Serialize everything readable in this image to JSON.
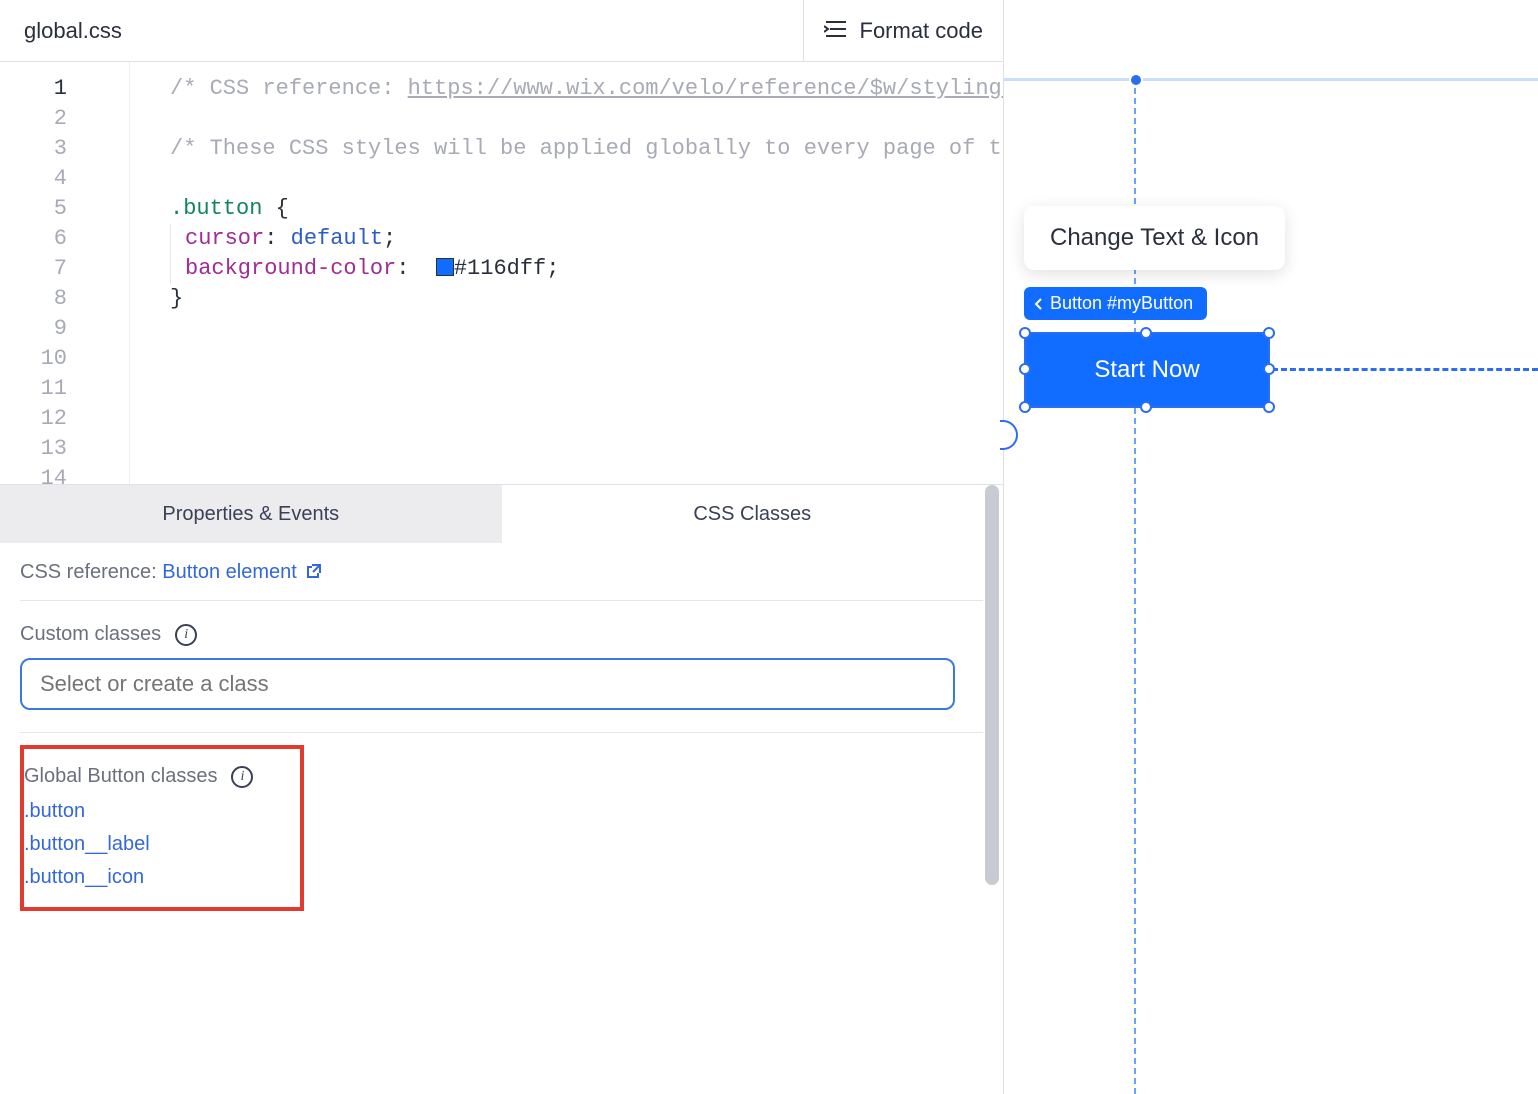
{
  "header": {
    "filename": "global.css",
    "format_label": "Format code"
  },
  "editor": {
    "line_count": 14,
    "active_line": 1,
    "lines": {
      "l1_comment_prefix": "/* CSS reference: ",
      "l1_link": "https://www.wix.com/velo/reference/$w/styling-elem",
      "l3_comment": "/* These CSS styles will be applied globally to every page of this s",
      "l5_selector": ".button",
      "l5_brace": " {",
      "l6_prop": "cursor",
      "l6_value": "default",
      "l7_prop": "background-color",
      "l7_hex": "#116dff",
      "l8_brace": "}"
    },
    "swatch_color": "#116dff"
  },
  "panel": {
    "tabs": {
      "properties": "Properties & Events",
      "css": "CSS Classes"
    },
    "ref_label": "CSS reference: ",
    "ref_link": "Button element",
    "custom_label": "Custom classes",
    "custom_placeholder": "Select or create a class",
    "global_label": "Global Button classes",
    "global_classes": [
      ".button",
      ".button__label",
      ".button__icon"
    ]
  },
  "canvas": {
    "popover_label": "Change Text & Icon",
    "crumb_label": "Button #myButton",
    "button_text": "Start Now"
  }
}
